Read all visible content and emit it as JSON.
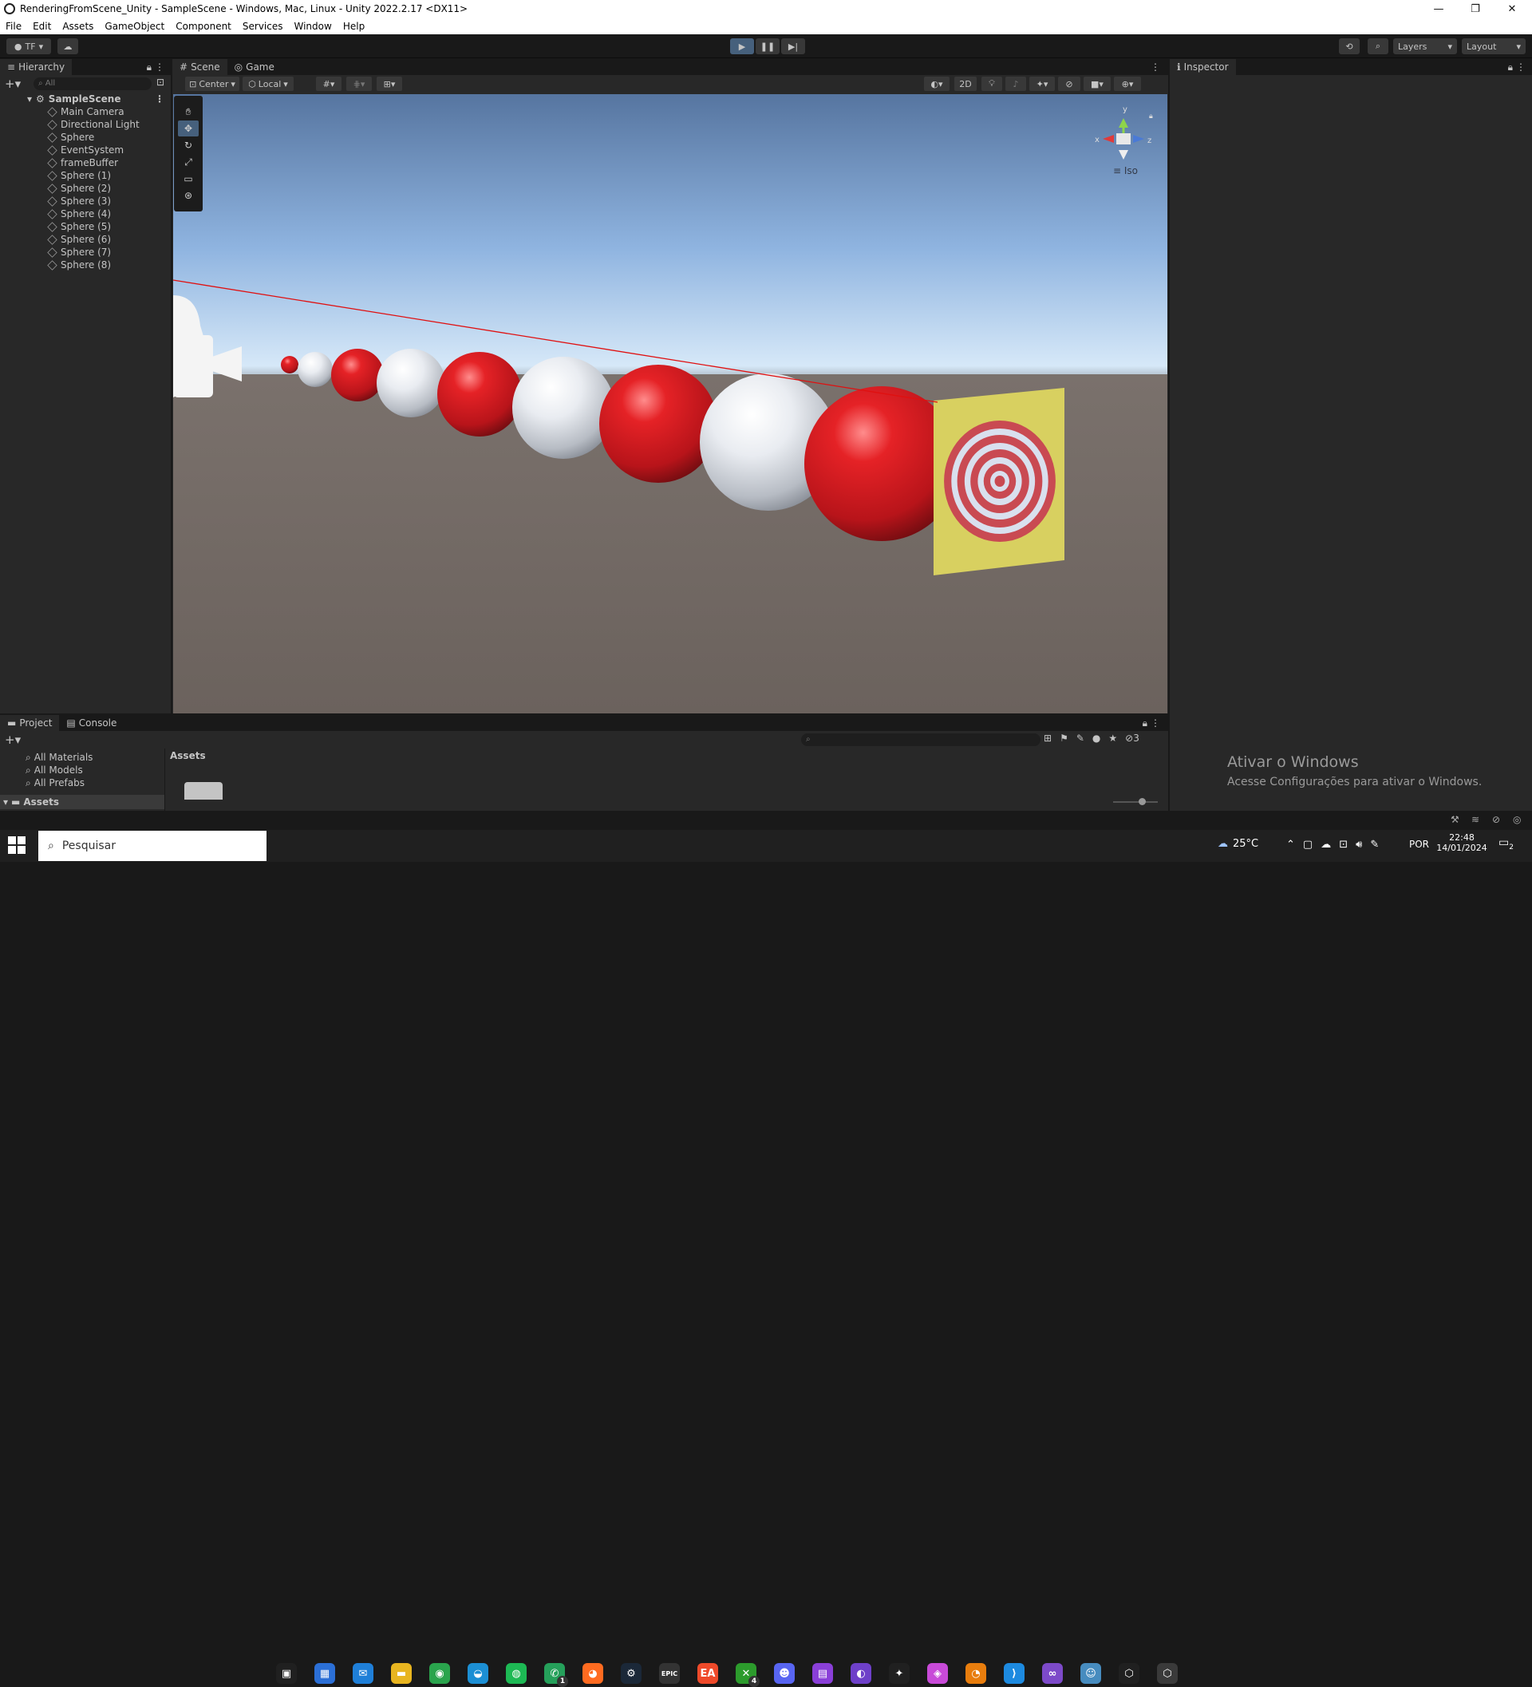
{
  "window": {
    "title": "RenderingFromScene_Unity - SampleScene - Windows, Mac, Linux - Unity 2022.2.17 <DX11>",
    "minimize": "—",
    "maximize": "❐",
    "close": "✕"
  },
  "menu": [
    "File",
    "Edit",
    "Assets",
    "GameObject",
    "Component",
    "Services",
    "Window",
    "Help"
  ],
  "toolbar": {
    "account": "TF",
    "layers": "Layers",
    "layout": "Layout"
  },
  "hierarchy": {
    "tab": "Hierarchy",
    "search_placeholder": "All",
    "scene": "SampleScene",
    "items": [
      "Main Camera",
      "Directional Light",
      "Sphere",
      "EventSystem",
      "frameBuffer",
      "Sphere (1)",
      "Sphere (2)",
      "Sphere (3)",
      "Sphere (4)",
      "Sphere (5)",
      "Sphere (6)",
      "Sphere (7)",
      "Sphere (8)"
    ]
  },
  "scene_view": {
    "tabs": [
      "Scene",
      "Game"
    ],
    "pivot": "Center",
    "space": "Local",
    "mode_2d": "2D",
    "gizmo_y": "y",
    "gizmo_x": "x",
    "gizmo_z": "z",
    "projection": "Iso"
  },
  "inspector": {
    "tab": "Inspector"
  },
  "project": {
    "tabs": [
      "Project",
      "Console"
    ],
    "favorites": [
      "All Materials",
      "All Models",
      "All Prefabs"
    ],
    "assets_label": "Assets",
    "breadcrumb": "Assets",
    "hidden_count": "3"
  },
  "watermark": {
    "title": "Ativar o Windows",
    "subtitle": "Acesse Configurações para ativar o Windows."
  },
  "taskbar": {
    "search_placeholder": "Pesquisar",
    "weather": "25°C",
    "language": "POR",
    "time": "22:48",
    "date": "14/01/2024",
    "notifications": "2",
    "whatsapp_badge": "1",
    "xbox_badge": "4",
    "epic_label": "EPIC"
  },
  "colors": {
    "editor_bg": "#191919",
    "panel_bg": "#282828",
    "accent": "#46607c",
    "sphere_red": "#c8181c",
    "target_yellow": "#d8d060"
  }
}
